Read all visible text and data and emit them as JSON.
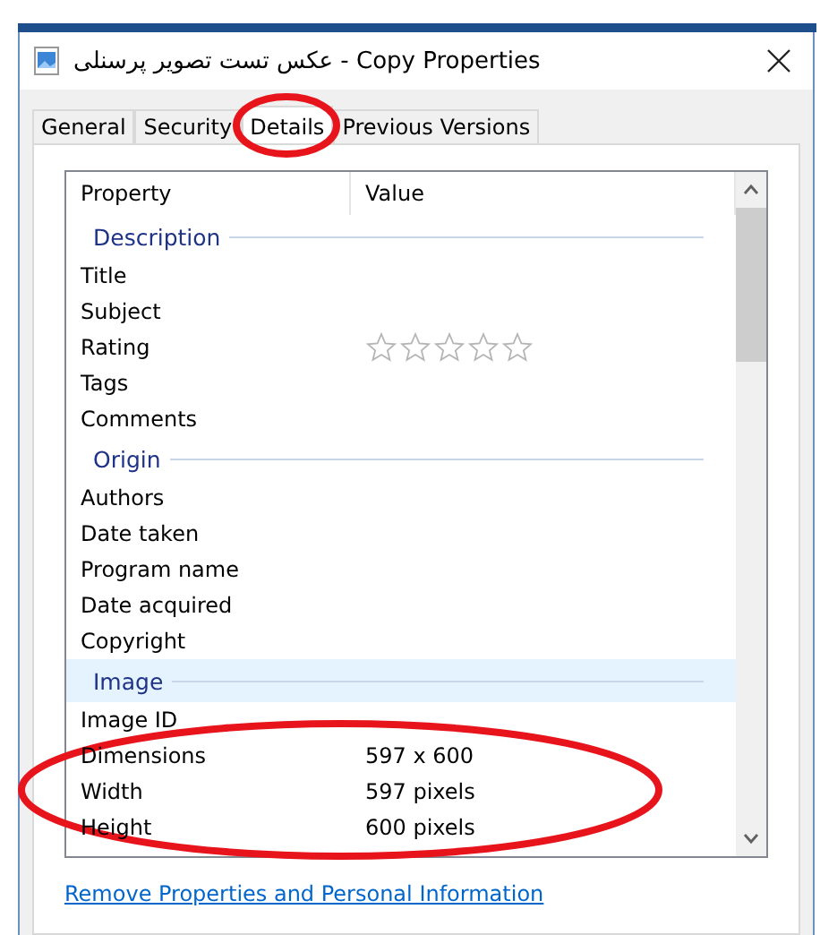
{
  "window": {
    "title": "عکس تست تصویر پرسنلی - Copy Properties"
  },
  "tabs": [
    {
      "label": "General",
      "selected": false
    },
    {
      "label": "Security",
      "selected": false
    },
    {
      "label": "Details",
      "selected": true
    },
    {
      "label": "Previous Versions",
      "selected": false
    }
  ],
  "table": {
    "columns": [
      "Property",
      "Value"
    ],
    "rows": [
      {
        "kind": "group",
        "label": "Description",
        "selected": false
      },
      {
        "kind": "field",
        "property": "Title"
      },
      {
        "kind": "field",
        "property": "Subject"
      },
      {
        "kind": "rating",
        "property": "Rating",
        "stars": 0
      },
      {
        "kind": "field",
        "property": "Tags"
      },
      {
        "kind": "field",
        "property": "Comments"
      },
      {
        "kind": "group",
        "label": "Origin",
        "selected": false
      },
      {
        "kind": "field",
        "property": "Authors"
      },
      {
        "kind": "field",
        "property": "Date taken"
      },
      {
        "kind": "field",
        "property": "Program name"
      },
      {
        "kind": "field",
        "property": "Date acquired"
      },
      {
        "kind": "field",
        "property": "Copyright"
      },
      {
        "kind": "group",
        "label": "Image",
        "selected": true
      },
      {
        "kind": "field",
        "property": "Image ID"
      },
      {
        "kind": "field",
        "property": "Dimensions",
        "value": "597 x 600"
      },
      {
        "kind": "field",
        "property": "Width",
        "value": "597 pixels"
      },
      {
        "kind": "field",
        "property": "Height",
        "value": "600 pixels"
      }
    ]
  },
  "link": "Remove Properties and Personal Information"
}
